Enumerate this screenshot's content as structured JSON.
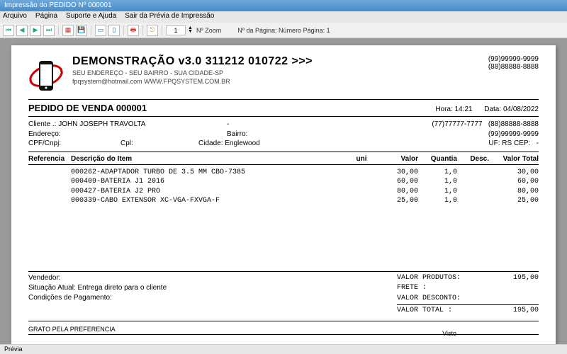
{
  "window": {
    "title": "Impressão do PEDIDO Nº 000001"
  },
  "menu": {
    "arquivo": "Arquivo",
    "pagina": "Página",
    "suporte": "Suporte e Ajuda",
    "sair": "Sair da Prévia de Impressão"
  },
  "toolbar": {
    "zoom_value": "1",
    "zoom_label": "Nº Zoom",
    "page_label": "Nº da Página: Número Página: 1"
  },
  "header": {
    "company": "DEMONSTRAÇÃO v3.0 311212 010722 >>>",
    "address": "SEU ENDEREÇO - SEU BAIRRO - SUA CIDADE-SP",
    "contact_line": "fpqsystem@hotmail.com  WWW.FPQSYSTEM.COM.BR",
    "phone1": "(99)99999-9999",
    "phone2": "(88)88888-8888"
  },
  "order": {
    "title": "PEDIDO DE VENDA 000001",
    "hora_label": "Hora:",
    "hora": "14:21",
    "data_label": "Data:",
    "data": "04/08/2022"
  },
  "customer": {
    "cliente_label": "Cliente   .:",
    "cliente": "JOHN JOSEPH TRAVOLTA",
    "dash": "-",
    "phone_a": "(77)77777-7777",
    "phone_b": "(88)88888-8888",
    "endereco_label": "Endereço:",
    "bairro_label": "Bairro:",
    "phone_c": "(99)99999-9999",
    "cpf_label": "CPF/Cnpj:",
    "cpl_label": "Cpl:",
    "cidade_label": "Cidade:",
    "cidade": "Englewood",
    "uf_label": "UF:",
    "uf": "RS",
    "cep_label": "CEP:",
    "cep": "-"
  },
  "cols": {
    "ref": "Referencia",
    "desc": "Descrição do Item",
    "uni": "uni",
    "valor": "Valor",
    "quantia": "Quantia",
    "desc2": "Desc.",
    "total": "Valor Total"
  },
  "items": [
    {
      "desc": "000262-ADAPTADOR TURBO DE 3.5 MM CBO-7385",
      "valor": "30,00",
      "qty": "1,0",
      "total": "30,00"
    },
    {
      "desc": "000409-BATERIA J1 2016",
      "valor": "60,00",
      "qty": "1,0",
      "total": "60,00"
    },
    {
      "desc": "000427-BATERIA J2 PRO",
      "valor": "80,00",
      "qty": "1,0",
      "total": "80,00"
    },
    {
      "desc": "000339-CABO EXTENSOR XC-VGA-FXVGA-F",
      "valor": "25,00",
      "qty": "1,0",
      "total": "25,00"
    }
  ],
  "footer": {
    "vendedor": "Vendedor:",
    "situacao_label": "Situação Atual:",
    "situacao": "Entrega direto para o cliente",
    "condicoes": "Condições de Pagamento:",
    "produtos_label": "VALOR PRODUTOS:",
    "produtos": "195,00",
    "frete_label": "FRETE         :",
    "desconto_label": "VALOR DESCONTO:",
    "total_label": "VALOR TOTAL   :",
    "total": "195,00",
    "thanks": "GRATO PELA PREFERENCIA",
    "visto": "Visto"
  },
  "statusbar": {
    "text": "Prévia"
  }
}
